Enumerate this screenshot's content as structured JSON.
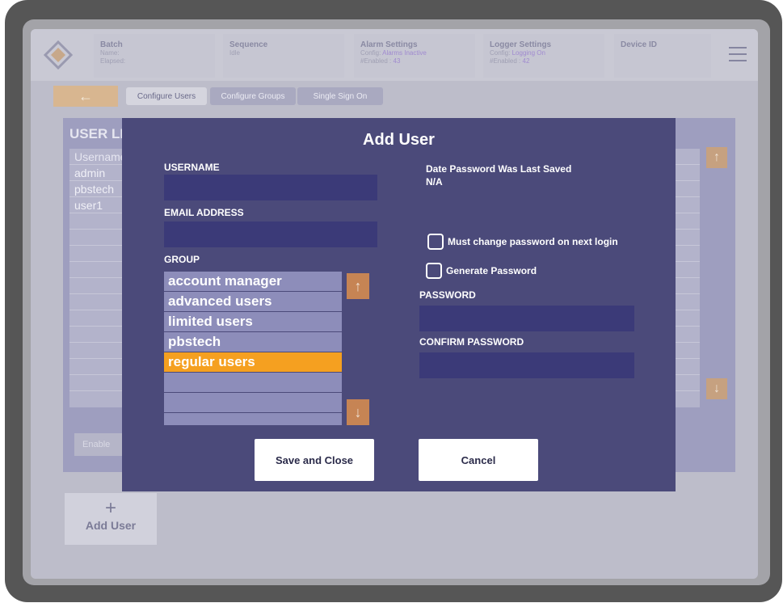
{
  "header": {
    "batch": {
      "title": "Batch",
      "name_label": "Name:",
      "elapsed_label": "Elapsed:"
    },
    "sequence": {
      "title": "Sequence",
      "value": "Idle"
    },
    "alarm": {
      "title": "Alarm Settings",
      "config_label": "Config:",
      "config_value": "Alarms Inactive",
      "enabled_label": "#Enabled :",
      "enabled_value": "43"
    },
    "logger": {
      "title": "Logger Settings",
      "config_label": "Config:",
      "config_value": "Logging On",
      "enabled_label": "#Enabled :",
      "enabled_value": "42"
    },
    "device": {
      "title": "Device ID"
    }
  },
  "tabs": [
    {
      "label": "Configure Users"
    },
    {
      "label": "Configure Groups"
    },
    {
      "label": "Single Sign On"
    }
  ],
  "user_list": {
    "title": "USER LIST",
    "header": "Username",
    "rows": [
      "admin",
      "pbstech",
      "user1"
    ],
    "enable_label": "Enable"
  },
  "add_user_card": {
    "label": "Add User"
  },
  "modal": {
    "title": "Add User",
    "username_label": "USERNAME",
    "username_value": "",
    "email_label": "EMAIL ADDRESS",
    "email_value": "",
    "group_label": "GROUP",
    "groups": [
      "account manager",
      "advanced users",
      "limited users",
      "pbstech",
      "regular users"
    ],
    "selected_group": "regular users",
    "date_label": "Date Password Was Last Saved",
    "date_value": "N/A",
    "must_change_label": "Must change password on next login",
    "generate_label": "Generate Password",
    "password_label": "PASSWORD",
    "confirm_label": "CONFIRM PASSWORD",
    "save_label": "Save and Close",
    "cancel_label": "Cancel"
  },
  "colors": {
    "modal_bg": "#4b4a7a",
    "input_bg": "#3b3a78",
    "selected_orange": "#f5a020",
    "arrow_btn": "#c68454"
  }
}
